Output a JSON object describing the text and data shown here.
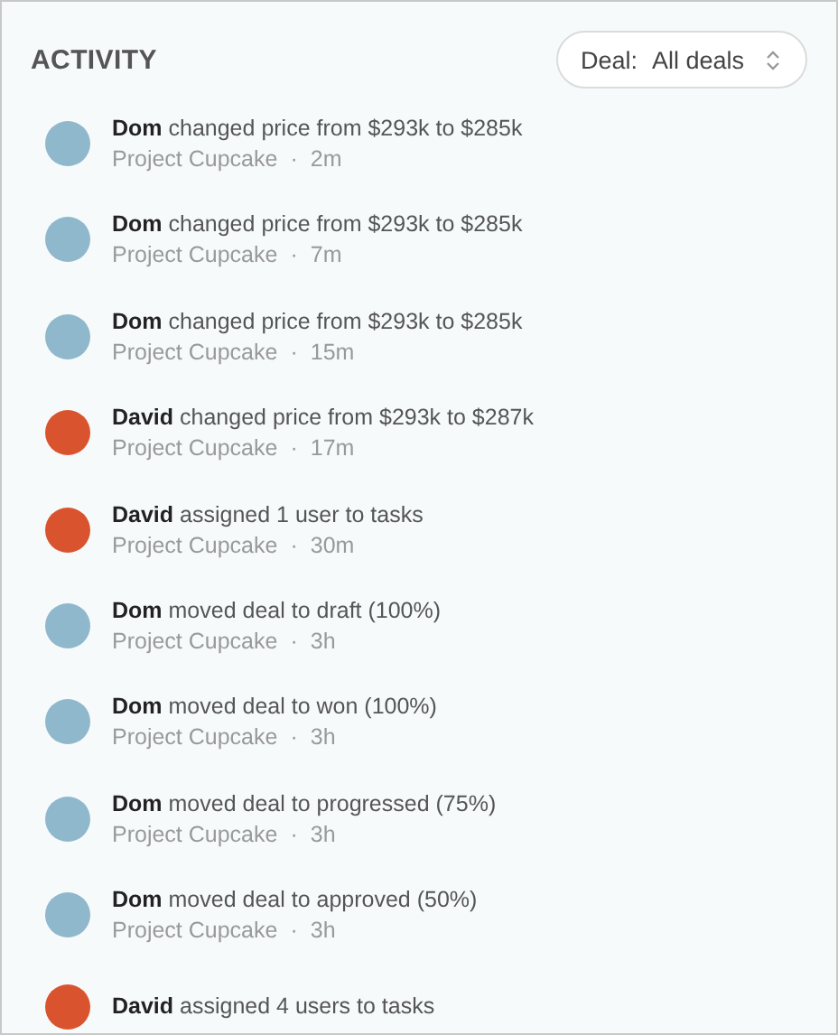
{
  "header": {
    "title": "ACTIVITY",
    "filter": {
      "label": "Deal:",
      "value": "All deals"
    }
  },
  "activities": [
    {
      "text": "**Dom** changed price from $293k to $285k",
      "project": "Project Cupcake",
      "separator": "·",
      "time": "2m",
      "color": "#8fb8cc"
    },
    {
      "text": "**Dom** changed price from $293k to $285k",
      "project": "Project Cupcake",
      "separator": "·",
      "time": "7m",
      "color": "#8fb8cc"
    },
    {
      "text": "**Dom** changed price from $293k to $285k",
      "project": "Project Cupcake",
      "separator": "·",
      "time": "15m",
      "color": "#8fb8cc"
    },
    {
      "text": "**David** changed price from $293k to $287k",
      "project": "Project Cupcake",
      "separator": "·",
      "time": "17m",
      "color": "#d9542e"
    },
    {
      "text": "**David** assigned 1 user to tasks",
      "project": "Project Cupcake",
      "separator": "·",
      "time": "30m",
      "color": "#d9542e"
    },
    {
      "text": "**Dom** moved deal to draft (100%)",
      "project": "Project Cupcake",
      "separator": "·",
      "time": "3h",
      "color": "#8fb8cc"
    },
    {
      "text": "**Dom** moved deal to won (100%)",
      "project": "Project Cupcake",
      "separator": "·",
      "time": "3h",
      "color": "#8fb8cc"
    },
    {
      "text": "**Dom** moved deal to progressed (75%)",
      "project": "Project Cupcake",
      "separator": "·",
      "time": "3h",
      "color": "#8fb8cc"
    },
    {
      "text": "**Dom** moved deal to approved (50%)",
      "project": "Project Cupcake",
      "separator": "·",
      "time": "3h",
      "color": "#8fb8cc"
    },
    {
      "text": "**David** assigned 4 users to tasks",
      "color": "#d9542e"
    }
  ]
}
